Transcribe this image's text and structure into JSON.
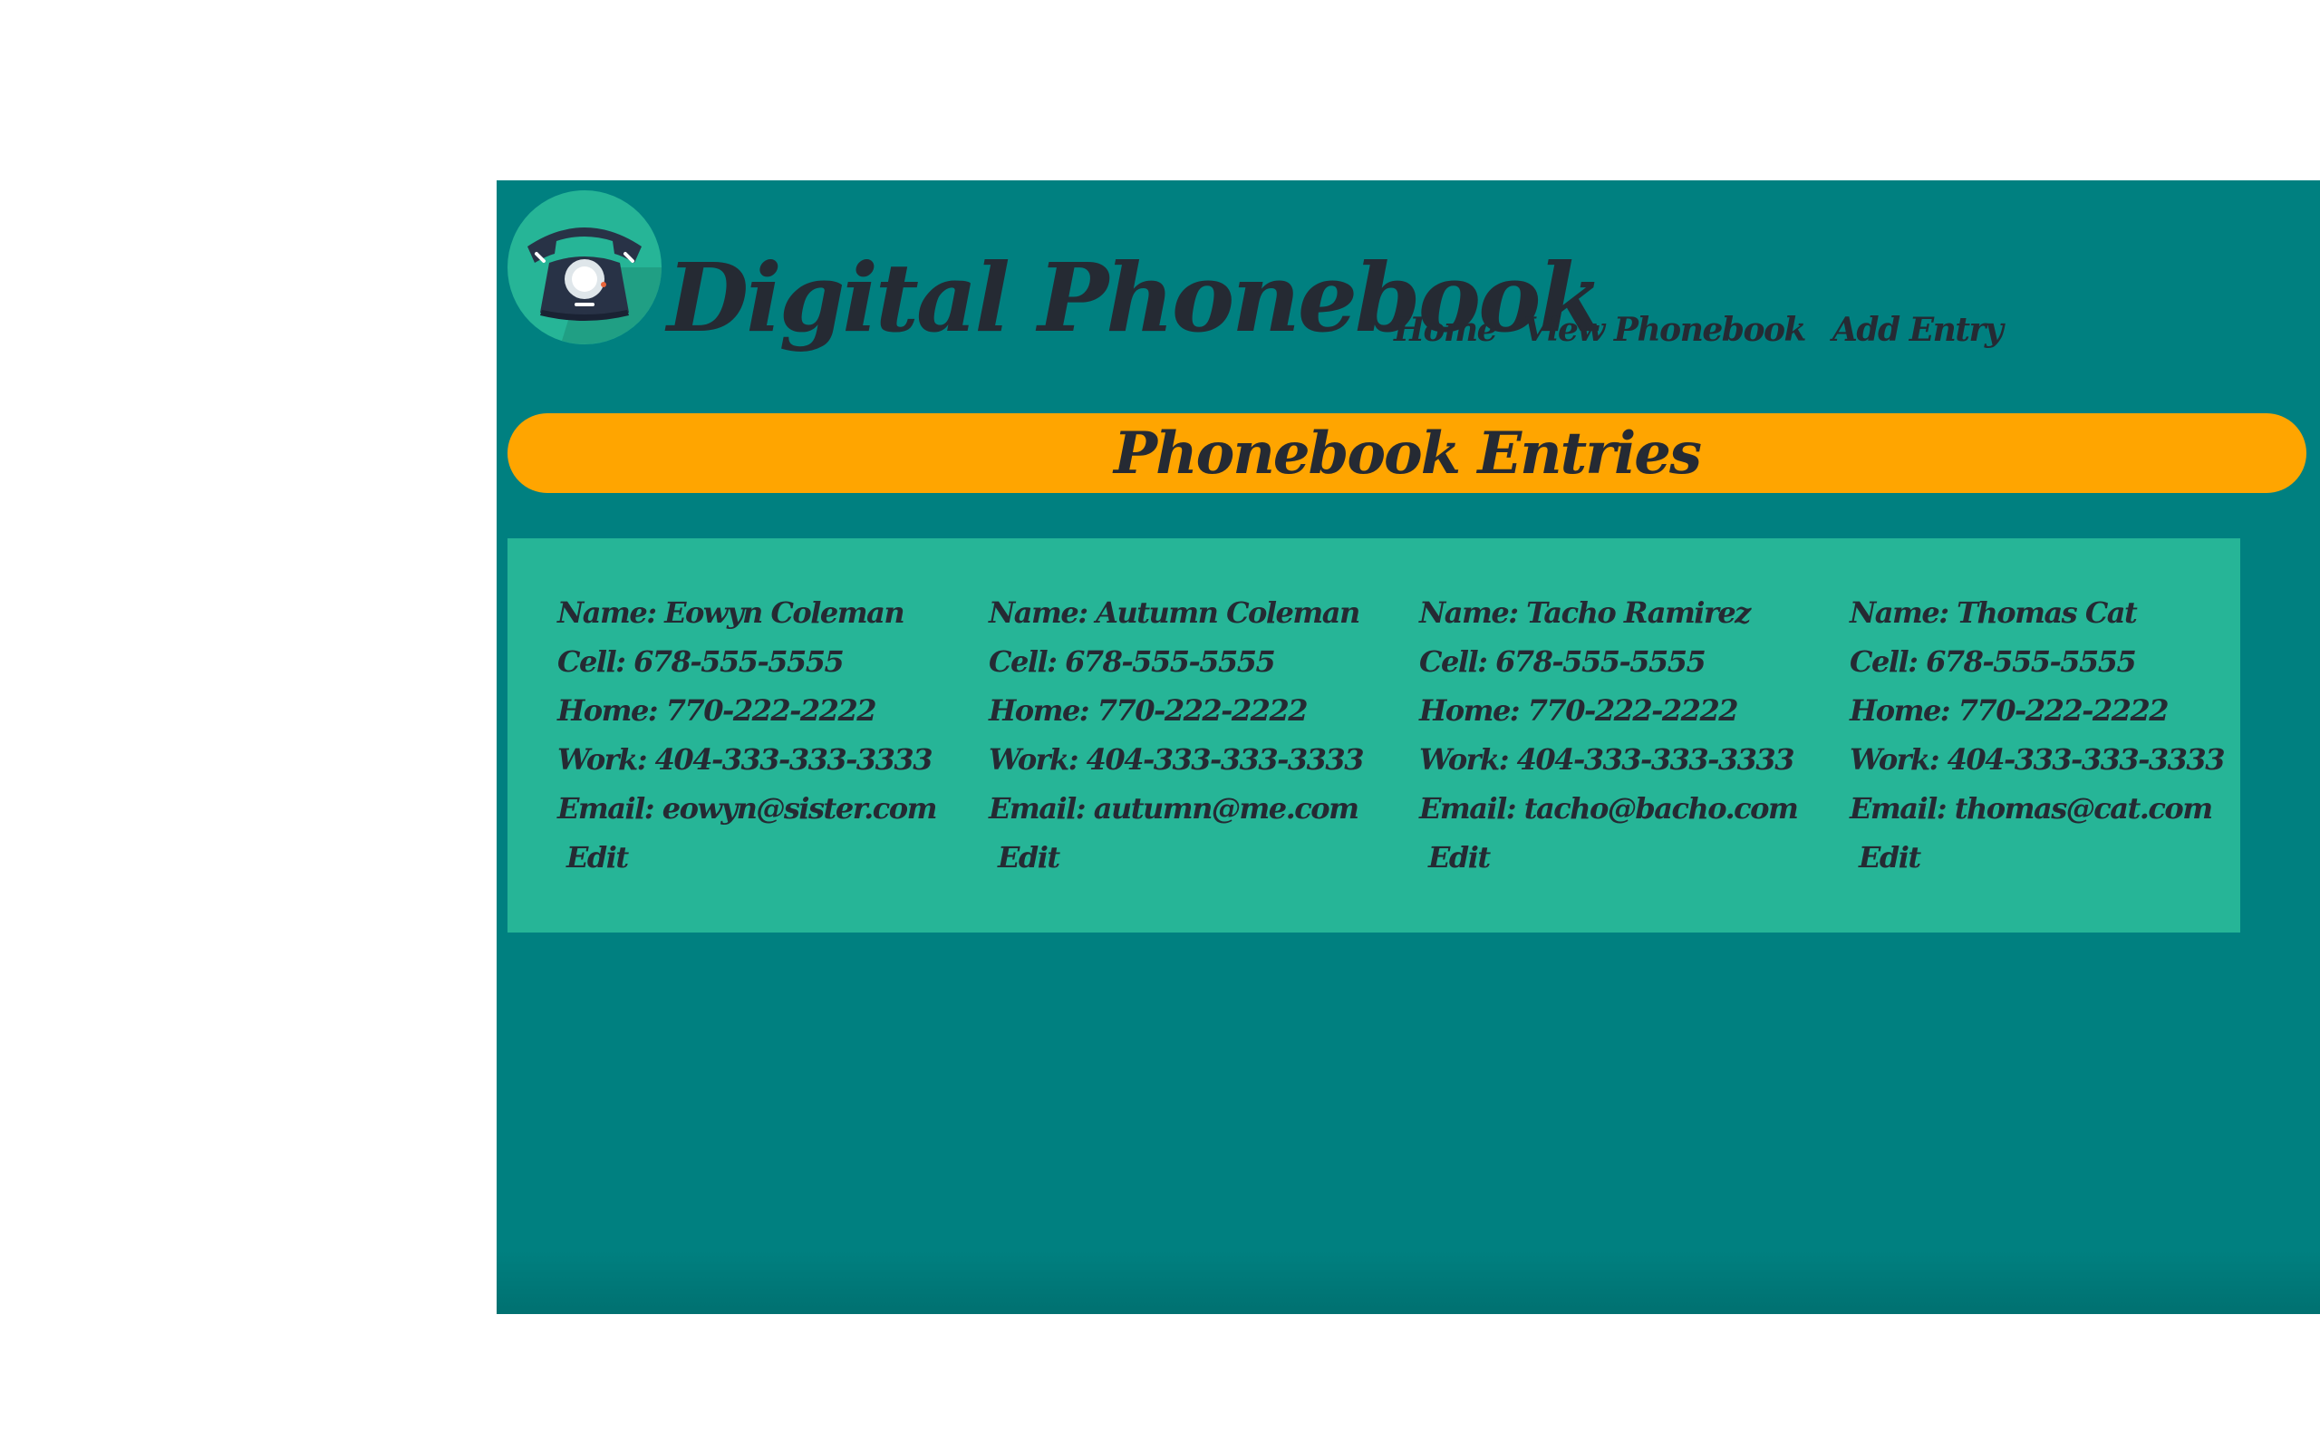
{
  "header": {
    "title": "Digital Phonebook",
    "logo_icon": "telephone-icon"
  },
  "nav": {
    "items": [
      {
        "label": "Home"
      },
      {
        "label": "View Phonebook"
      },
      {
        "label": "Add Entry"
      }
    ]
  },
  "banner": {
    "title": "Phonebook Entries"
  },
  "colors": {
    "panel": "#008080",
    "banner": "#ffa500",
    "entries_bg": "#26b597",
    "text": "#252a33"
  },
  "entries": [
    {
      "name": "Name: Eowyn Coleman",
      "cell": "Cell: 678-555-5555",
      "home": "Home: 770-222-2222",
      "work": "Work: 404-333-333-3333",
      "email": "Email: eowyn@sister.com",
      "edit_label": "Edit"
    },
    {
      "name": "Name: Autumn Coleman",
      "cell": "Cell: 678-555-5555",
      "home": "Home: 770-222-2222",
      "work": "Work: 404-333-333-3333",
      "email": "Email: autumn@me.com",
      "edit_label": "Edit"
    },
    {
      "name": "Name: Tacho Ramirez",
      "cell": "Cell: 678-555-5555",
      "home": "Home: 770-222-2222",
      "work": "Work: 404-333-333-3333",
      "email": "Email: tacho@bacho.com",
      "edit_label": "Edit"
    },
    {
      "name": "Name: Thomas Cat",
      "cell": "Cell: 678-555-5555",
      "home": "Home: 770-222-2222",
      "work": "Work: 404-333-333-3333",
      "email": "Email: thomas@cat.com",
      "edit_label": "Edit"
    }
  ]
}
